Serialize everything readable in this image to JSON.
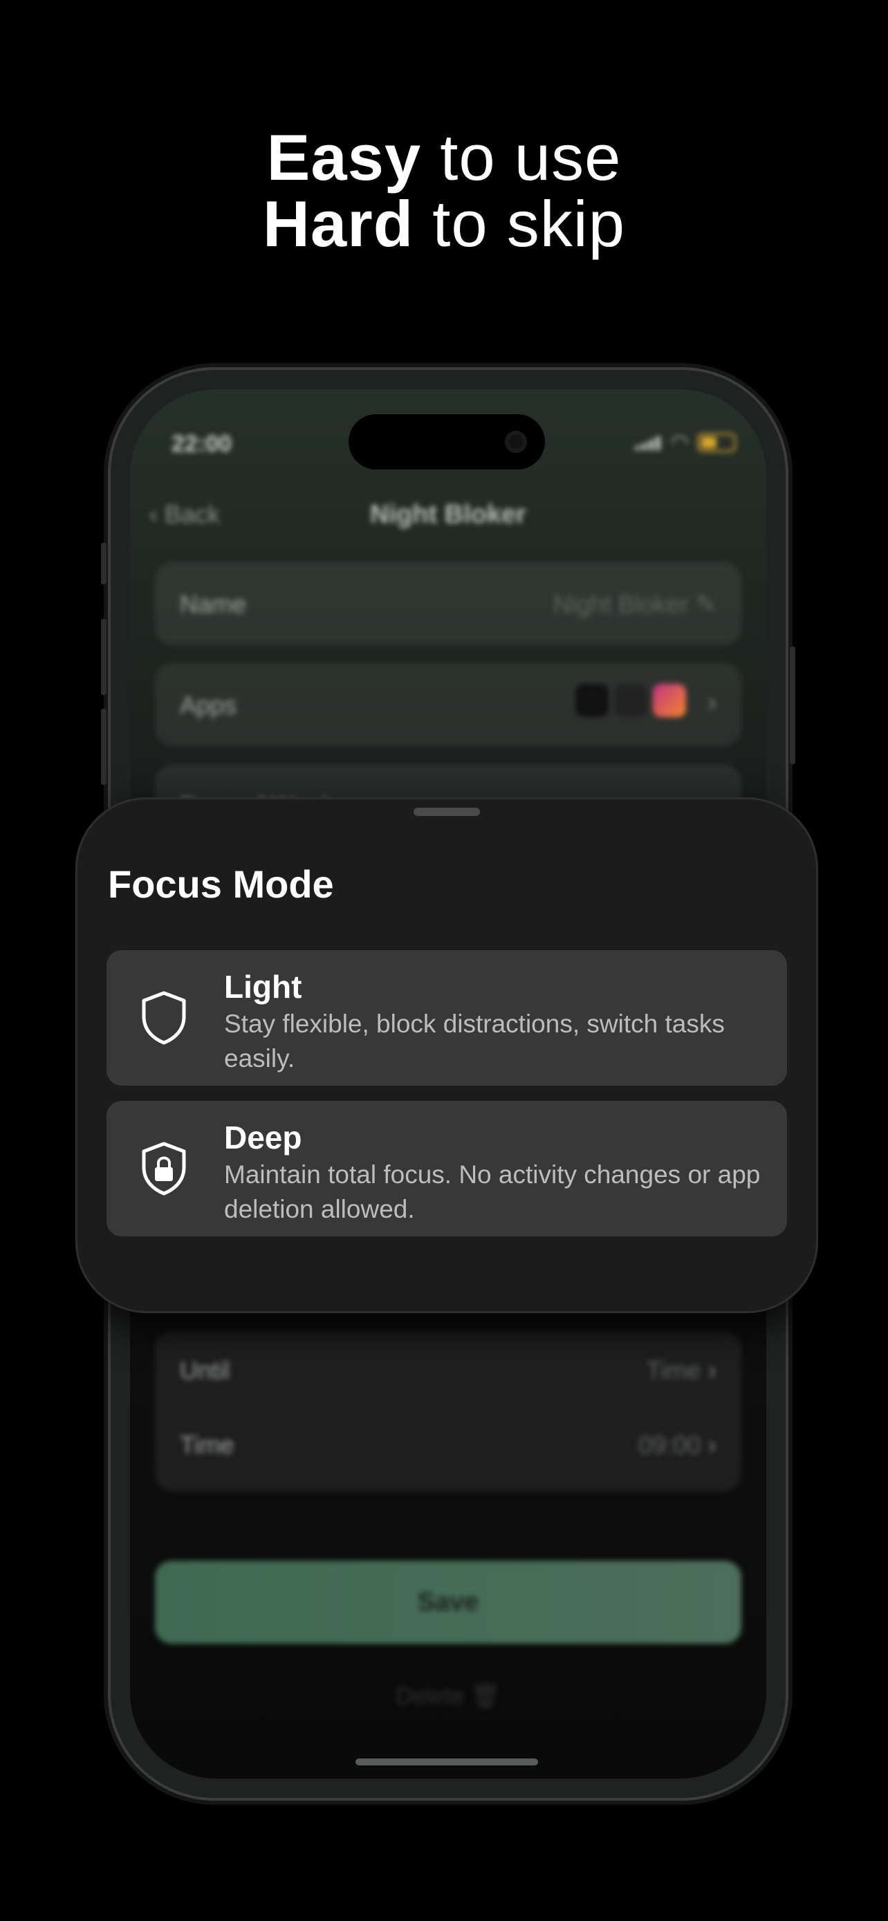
{
  "headline": {
    "line1_bold": "Easy",
    "line1_rest": "to use",
    "line2_bold": "Hard",
    "line2_rest": "to skip"
  },
  "status_bar": {
    "time": "22:00"
  },
  "nav": {
    "back_label": "Back",
    "title": "Night Bloker"
  },
  "form": {
    "name_label": "Name",
    "name_value": "Night Bloker",
    "apps_label": "Apps",
    "days_label": "Days of Week",
    "until_label": "Until",
    "until_value": "Time",
    "time_label": "Time",
    "time_value": "09:00",
    "save_label": "Save",
    "delete_label": "Delete"
  },
  "sheet": {
    "title": "Focus Mode",
    "options": [
      {
        "name": "Light",
        "description": "Stay flexible, block distractions, switch tasks easily.",
        "icon": "shield-icon"
      },
      {
        "name": "Deep",
        "description": "Maintain total focus. No activity changes or app deletion allowed.",
        "icon": "shield-lock-icon"
      }
    ]
  },
  "colors": {
    "background": "#000000",
    "sheet": "#1c1c1c",
    "option_card": "#383838",
    "save_button": "#4c6e5a",
    "battery": "#d9a92c"
  }
}
